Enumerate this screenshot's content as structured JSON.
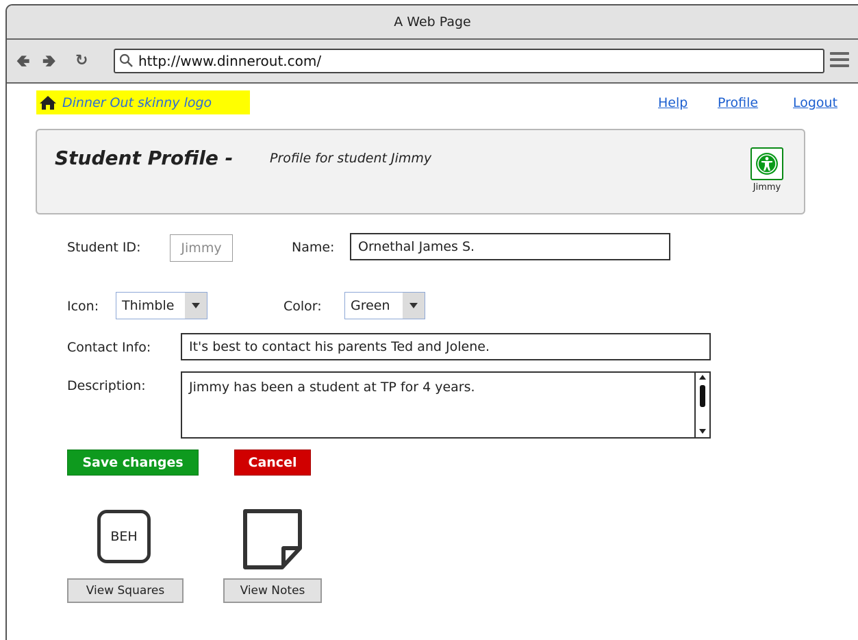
{
  "browser": {
    "window_title": "A Web Page",
    "url": "http://www.dinnerout.com/"
  },
  "site": {
    "logo_text": "Dinner Out skinny logo",
    "nav": {
      "help": "Help",
      "profile": "Profile",
      "logout": "Logout"
    }
  },
  "header": {
    "title": "Student Profile -",
    "subtitle": "Profile for student Jimmy",
    "avatar_label": "Jimmy"
  },
  "form": {
    "student_id_label": "Student ID:",
    "student_id_value": "Jimmy",
    "name_label": "Name:",
    "name_value": "Ornethal James S.",
    "icon_label": "Icon:",
    "icon_value": "Thimble",
    "color_label": "Color:",
    "color_value": "Green",
    "contact_label": "Contact Info:",
    "contact_value": "It's best to contact his parents Ted and Jolene.",
    "description_label": "Description:",
    "description_value": "Jimmy has been a student at TP for 4 years."
  },
  "actions": {
    "save": "Save changes",
    "cancel": "Cancel"
  },
  "shortcuts": {
    "squares_icon_text": "BEH",
    "view_squares": "View Squares",
    "view_notes": "View Notes"
  },
  "colors": {
    "save": "#0e9a1e",
    "cancel": "#d00000",
    "logo_bg": "#ffff00",
    "link": "#1c5fd0"
  }
}
